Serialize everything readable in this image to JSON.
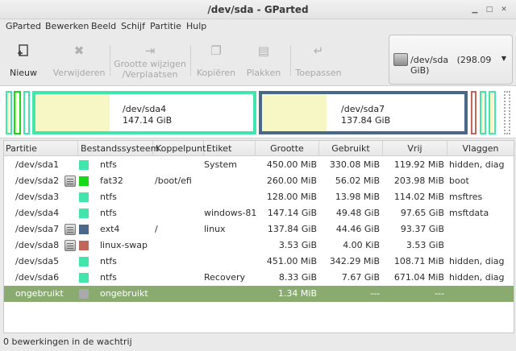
{
  "window": {
    "title": "/dev/sda - GParted"
  },
  "menu": [
    "GParted",
    "Bewerken",
    "Beeld",
    "Schijf",
    "Partitie",
    "Hulp"
  ],
  "toolbar": {
    "new": "Nieuw",
    "delete": "Verwijderen",
    "resize_line1": "Grootte wijzigen",
    "resize_line2": "/Verplaatsen",
    "copy": "Kopiëren",
    "paste": "Plakken",
    "apply": "Toepassen"
  },
  "device": {
    "name": "/dev/sda",
    "size": "(298.09 GiB)"
  },
  "disk_map": [
    {
      "name": "/dev/sda4",
      "size": "147.14 GiB"
    },
    {
      "name": "/dev/sda7",
      "size": "137.84 GiB"
    }
  ],
  "table": {
    "headers": [
      "Partitie",
      "Bestandssysteem",
      "Koppelpunt",
      "Etiket",
      "Grootte",
      "Gebruikt",
      "Vrij",
      "Vlaggen"
    ],
    "rows": [
      {
        "partition": "/dev/sda1",
        "fs": "ntfs",
        "mount": "",
        "label": "System",
        "size": "450.00 MiB",
        "used": "330.08 MiB",
        "free": "119.92 MiB",
        "flags": "hidden, diag"
      },
      {
        "partition": "/dev/sda2",
        "fs": "fat32",
        "mount": "/boot/efi",
        "label": "",
        "size": "260.00 MiB",
        "used": "56.02 MiB",
        "free": "203.98 MiB",
        "flags": "boot"
      },
      {
        "partition": "/dev/sda3",
        "fs": "ntfs",
        "mount": "",
        "label": "",
        "size": "128.00 MiB",
        "used": "13.98 MiB",
        "free": "114.02 MiB",
        "flags": "msftres"
      },
      {
        "partition": "/dev/sda4",
        "fs": "ntfs",
        "mount": "",
        "label": "windows-81",
        "size": "147.14 GiB",
        "used": "49.48 GiB",
        "free": "97.65 GiB",
        "flags": "msftdata"
      },
      {
        "partition": "/dev/sda7",
        "fs": "ext4",
        "mount": "/",
        "label": "linux",
        "size": "137.84 GiB",
        "used": "44.46 GiB",
        "free": "93.37 GiB",
        "flags": ""
      },
      {
        "partition": "/dev/sda8",
        "fs": "linux-swap",
        "mount": "",
        "label": "",
        "size": "3.53 GiB",
        "used": "4.00 KiB",
        "free": "3.53 GiB",
        "flags": ""
      },
      {
        "partition": "/dev/sda5",
        "fs": "ntfs",
        "mount": "",
        "label": "",
        "size": "451.00 MiB",
        "used": "342.29 MiB",
        "free": "108.71 MiB",
        "flags": "hidden, diag"
      },
      {
        "partition": "/dev/sda6",
        "fs": "ntfs",
        "mount": "",
        "label": "Recovery",
        "size": "8.33 GiB",
        "used": "7.67 GiB",
        "free": "671.04 MiB",
        "flags": "hidden, diag"
      },
      {
        "partition": "ongebruikt",
        "fs": "ongebruikt",
        "mount": "",
        "label": "",
        "size": "1.34 MiB",
        "used": "---",
        "free": "---",
        "flags": ""
      }
    ]
  },
  "status": "0 bewerkingen in de wachtrij",
  "colors": {
    "ntfs": "#42e5ac",
    "fat32": "#18d918",
    "ext4": "#4a6988",
    "linux_swap": "#c1665a",
    "unallocated": "#a9a9a9",
    "used_fill": "#f7f7c6",
    "selection": "#8aab70"
  }
}
